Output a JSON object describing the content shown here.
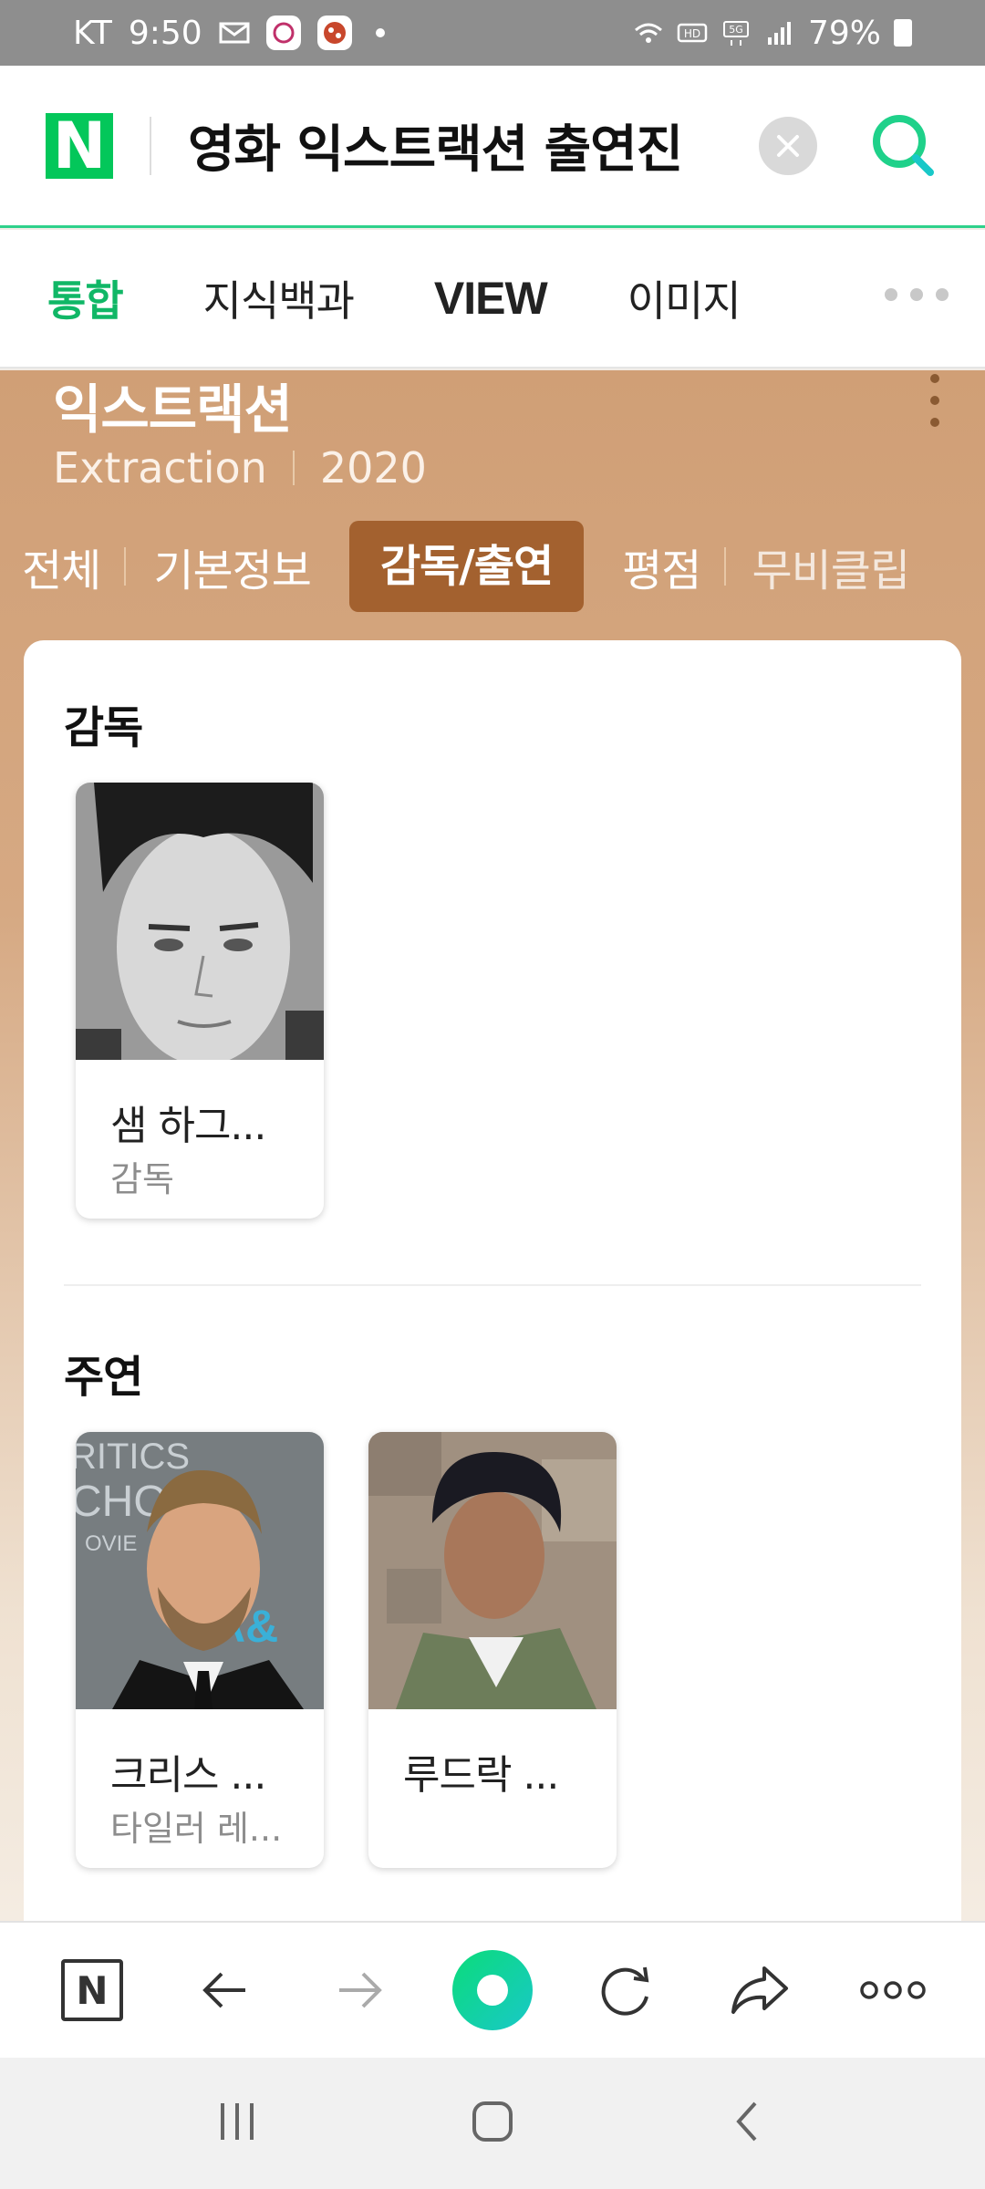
{
  "status_bar": {
    "carrier": "KT",
    "time": "9:50",
    "battery": "79%"
  },
  "search": {
    "logo": "N",
    "query": "영화 익스트랙션 출연진"
  },
  "tabs": [
    {
      "label": "통합",
      "active": true
    },
    {
      "label": "지식백과",
      "active": false
    },
    {
      "label": "VIEW",
      "active": false
    },
    {
      "label": "이미지",
      "active": false
    }
  ],
  "movie": {
    "title": "익스트랙션",
    "original_title": "Extraction",
    "year": "2020",
    "subtabs": [
      {
        "label": "전체"
      },
      {
        "label": "기본정보"
      },
      {
        "label": "감독/출연",
        "active": true
      },
      {
        "label": "평점"
      },
      {
        "label": "무비클립"
      }
    ]
  },
  "credits": {
    "director_section": {
      "title": "감독",
      "people": [
        {
          "name": "샘 하그...",
          "role": "감독"
        }
      ]
    },
    "lead_section": {
      "title": "주연",
      "people": [
        {
          "name": "크리스 ...",
          "role": "타일러 레..."
        },
        {
          "name": "루드락 ...",
          "role": ""
        }
      ]
    }
  },
  "bottom_bar": {
    "home_logo": "N"
  },
  "colors": {
    "naver_green": "#03c75a",
    "active_tab": "#10b766",
    "movie_bg": "#d09f76",
    "active_subtab": "#a3612f"
  }
}
